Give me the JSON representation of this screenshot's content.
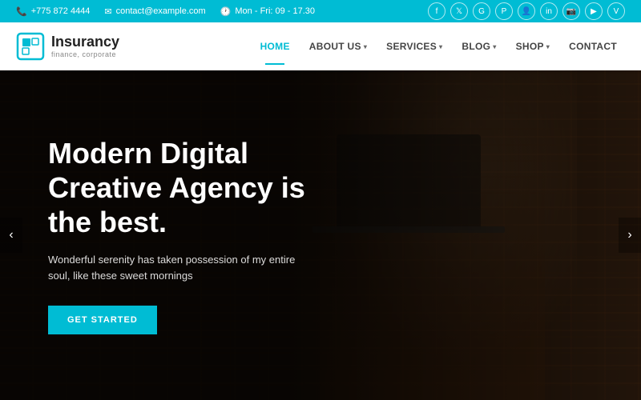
{
  "topbar": {
    "phone": "+775 872 4444",
    "email": "contact@example.com",
    "hours": "Mon - Fri: 09 - 17.30",
    "phone_icon": "📞",
    "email_icon": "✉",
    "clock_icon": "🕐"
  },
  "social_icons": [
    {
      "name": "facebook",
      "label": "f"
    },
    {
      "name": "twitter",
      "label": "t"
    },
    {
      "name": "google-plus",
      "label": "g+"
    },
    {
      "name": "pinterest",
      "label": "p"
    },
    {
      "name": "user",
      "label": "u"
    },
    {
      "name": "linkedin",
      "label": "in"
    },
    {
      "name": "instagram",
      "label": "ig"
    },
    {
      "name": "youtube",
      "label": "yt"
    },
    {
      "name": "vk",
      "label": "vk"
    }
  ],
  "logo": {
    "title": "Insurancy",
    "subtitle": "finance, corporate"
  },
  "nav": {
    "items": [
      {
        "label": "HOME",
        "active": true,
        "has_arrow": false
      },
      {
        "label": "ABOUT US",
        "active": false,
        "has_arrow": true
      },
      {
        "label": "SERVICES",
        "active": false,
        "has_arrow": true
      },
      {
        "label": "BLOG",
        "active": false,
        "has_arrow": true
      },
      {
        "label": "SHOP",
        "active": false,
        "has_arrow": true
      },
      {
        "label": "CONTACT",
        "active": false,
        "has_arrow": false
      }
    ]
  },
  "hero": {
    "title": "Modern Digital Creative Agency is the best.",
    "subtitle": "Wonderful serenity has taken possession of my entire soul, like these sweet mornings",
    "cta_label": "GET STARTED",
    "prev_label": "‹",
    "next_label": "›"
  }
}
